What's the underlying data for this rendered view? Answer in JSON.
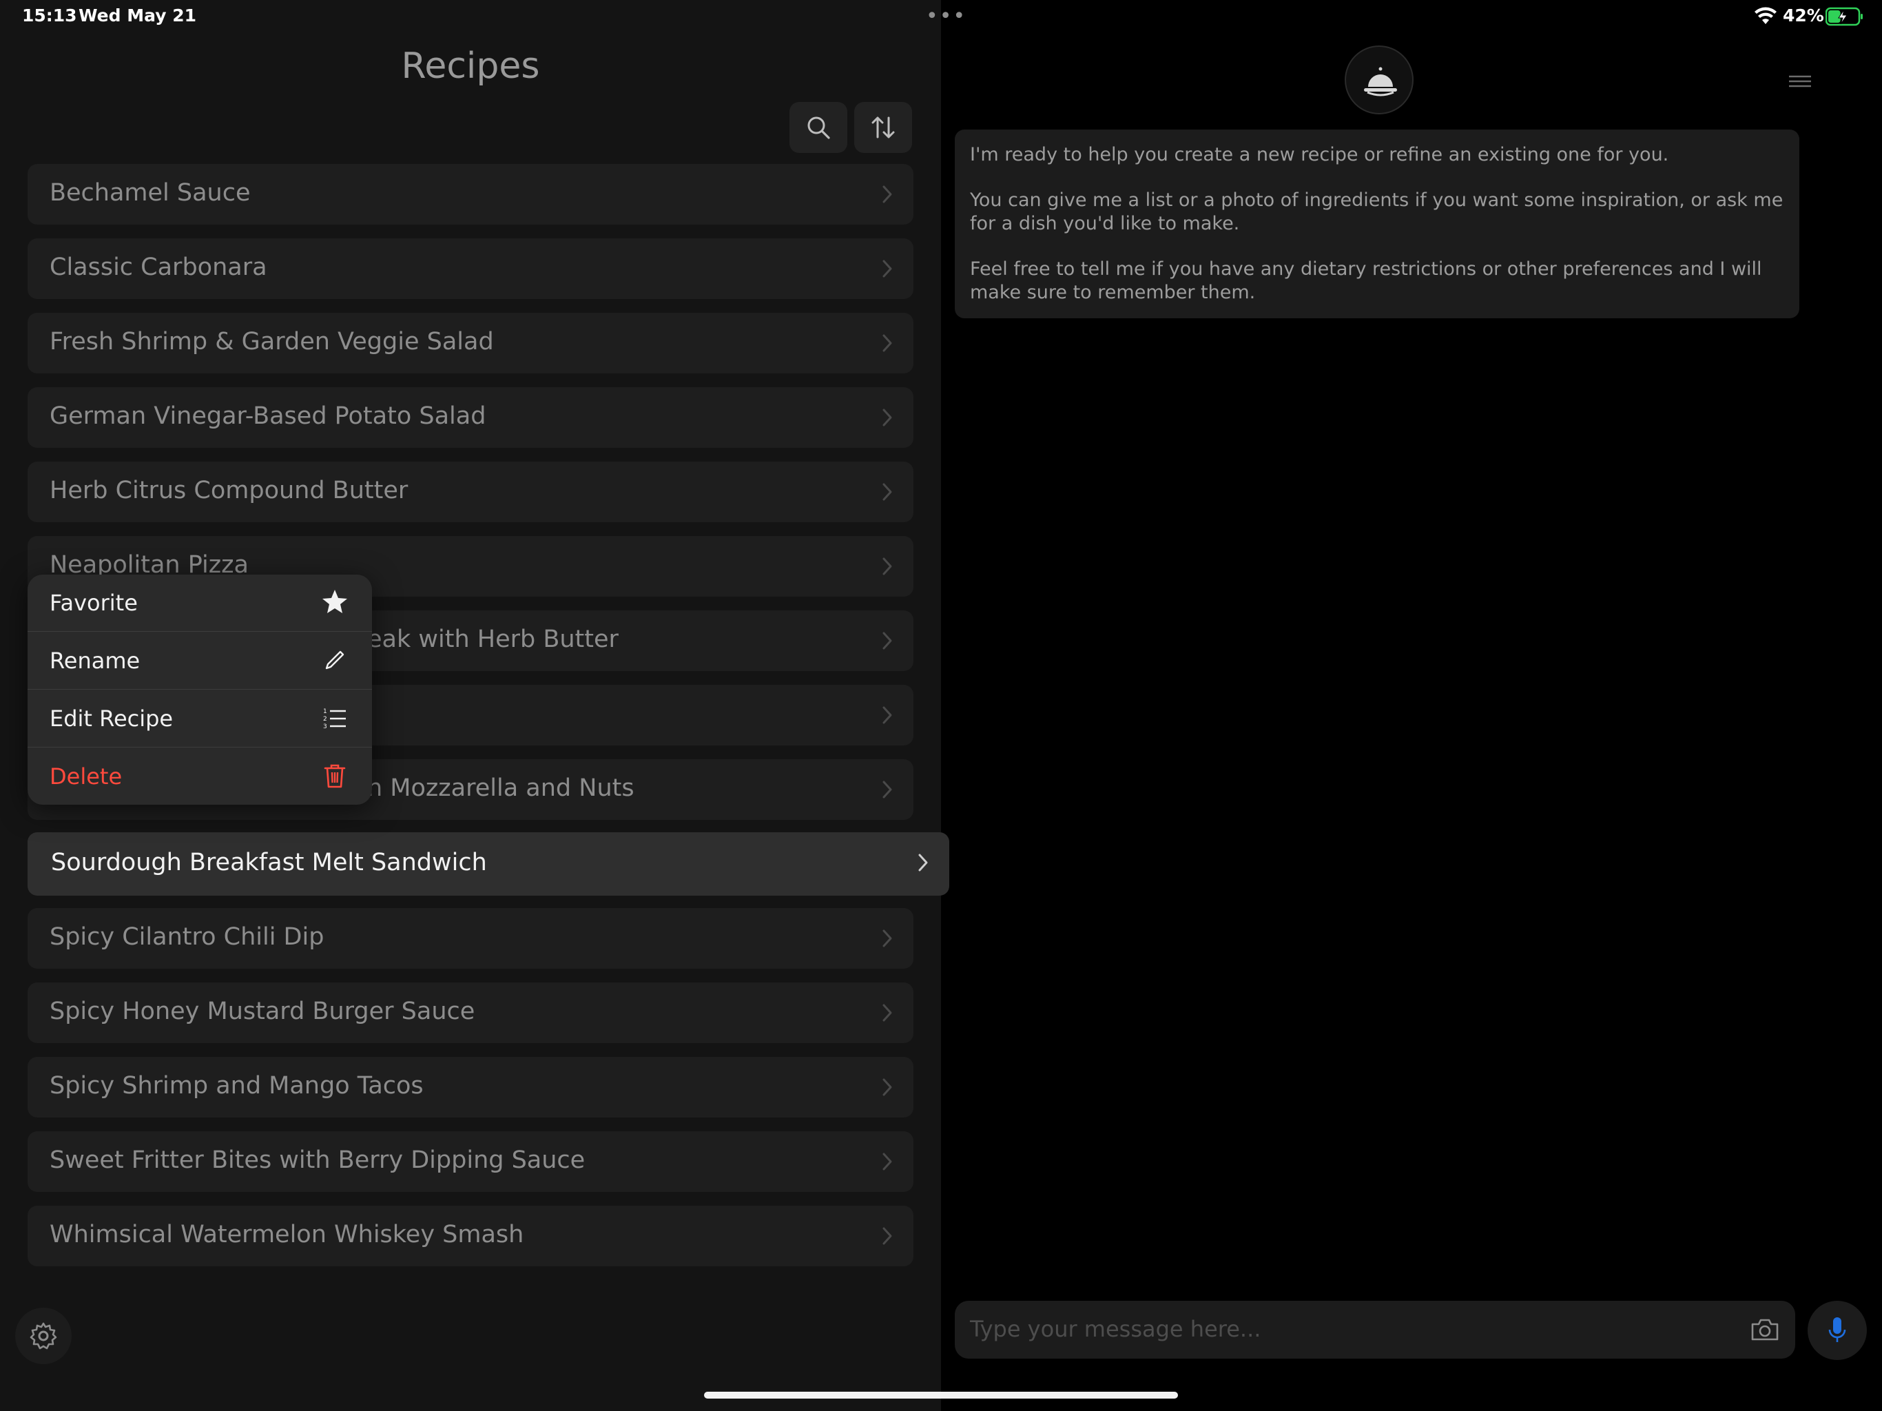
{
  "status_bar": {
    "time": "15:13",
    "date": "Wed May 21",
    "battery_percent": "42%",
    "battery_level": 0.42,
    "charging": true
  },
  "recipes_panel": {
    "title": "Recipes",
    "items": [
      "Bechamel Sauce",
      "Classic Carbonara",
      "Fresh Shrimp & Garden Veggie Salad",
      "German Vinegar-Based Potato Salad",
      "Herb Citrus Compound Butter",
      "Neapolitan Pizza",
      "eak with Herb Butter",
      "",
      "h Mozzarella and Nuts",
      "Sourdough Breakfast Melt Sandwich",
      "Spicy Cilantro Chili Dip",
      "Spicy Honey Mustard Burger Sauce",
      "Spicy Shrimp and Mango Tacos",
      "Sweet Fritter Bites with Berry Dipping Sauce",
      "Whimsical Watermelon Whiskey Smash"
    ],
    "selected_item": "Sourdough Breakfast Melt Sandwich"
  },
  "context_menu": {
    "favorite": "Favorite",
    "rename": "Rename",
    "edit": "Edit Recipe",
    "delete": "Delete"
  },
  "chat": {
    "assistant_message": [
      "I'm ready to help you create a new recipe or refine an existing one for you.",
      "You can give me a list or a photo of ingredients if you want some inspiration, or ask me for a dish you'd like to make.",
      "Feel free to tell me if you have any dietary restrictions or other preferences and I will make sure to remember them."
    ],
    "input_placeholder": "Type your message here..."
  },
  "colors": {
    "background": "#000000",
    "panel": "#141414",
    "row": "#1e1e1e",
    "selected_row": "#2f2f2f",
    "menu": "#2a2a2a",
    "danger": "#ff4a3d",
    "accent_mic": "#1f6fe0",
    "battery_green": "#30d158"
  },
  "icons": {
    "search": "search-icon",
    "sort": "sort-arrows-icon",
    "chevron": "chevron-right-icon",
    "favorite": "star-icon",
    "rename": "pencil-icon",
    "edit": "list-icon",
    "delete": "trash-icon",
    "settings": "gear-icon",
    "avatar": "cloche-icon",
    "menu": "hamburger-icon",
    "camera": "camera-icon",
    "mic": "microphone-icon"
  }
}
